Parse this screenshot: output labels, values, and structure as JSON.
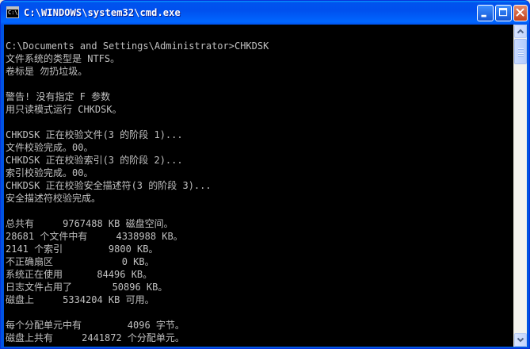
{
  "window": {
    "title": "C:\\WINDOWS\\system32\\cmd.exe",
    "icon": "cmd-console-icon",
    "icon_text": "C:\\"
  },
  "buttons": {
    "minimize": "minimize-icon",
    "maximize": "maximize-icon",
    "close": "close-icon"
  },
  "console": {
    "background": "#000000",
    "foreground": "#c0c0c0",
    "lines": [
      "",
      "C:\\Documents and Settings\\Administrator>CHKDSK",
      "文件系统的类型是 NTFS。",
      "卷标是 勿扔垃圾。",
      "",
      "警告! 没有指定 F 参数",
      "用只读模式运行 CHKDSK。",
      "",
      "CHKDSK 正在校验文件(3 的阶段 1)...",
      "文件校验完成。00。",
      "CHKDSK 正在校验索引(3 的阶段 2)...",
      "索引校验完成。00。",
      "CHKDSK 正在校验安全描述符(3 的阶段 3)...",
      "安全描述符校验完成。",
      "",
      "总共有     9767488 KB 磁盘空间。",
      "28681 个文件中有     4338988 KB。",
      "2141 个索引        9800 KB。",
      "不正确扇区            0 KB。",
      "系统正在使用      84496 KB。",
      "日志文件占用了       50896 KB。",
      "磁盘上     5334204 KB 可用。",
      "",
      "每个分配单元中有        4096 字节。",
      "磁盘上共有     2441872 个分配单元。"
    ]
  },
  "scrollbar": {
    "up": "scroll-up-arrow-icon",
    "down": "scroll-down-arrow-icon"
  }
}
